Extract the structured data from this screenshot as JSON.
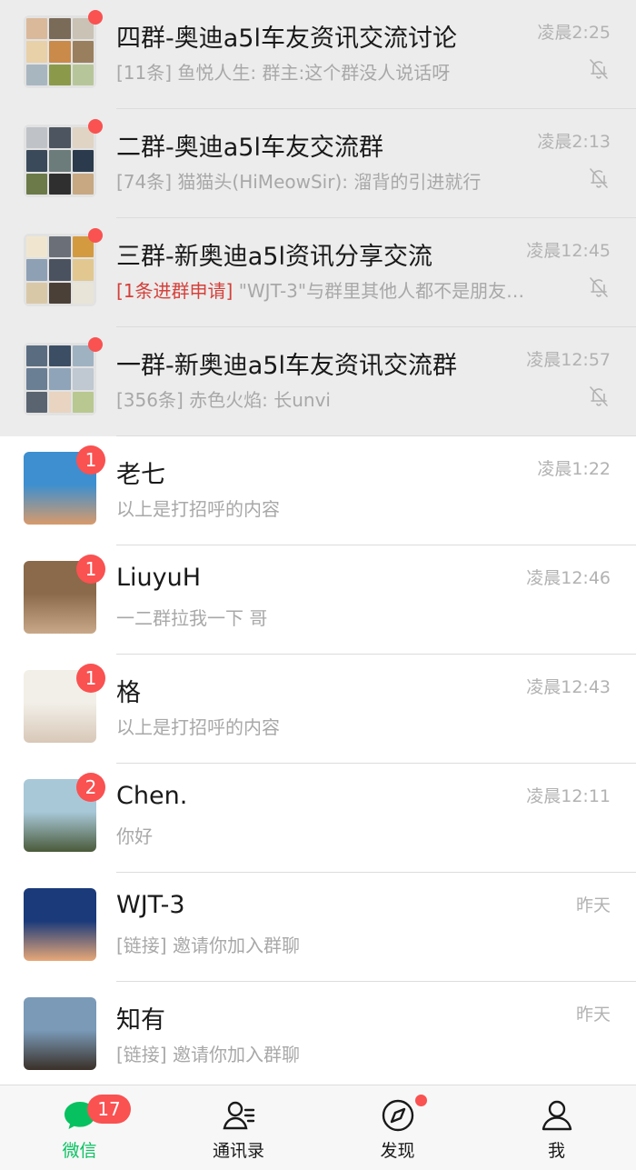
{
  "chats": [
    {
      "name": "四群-奥迪a5l车友资讯交流讨论",
      "time": "凌晨2:25",
      "prefix": "",
      "preview": "[11条] 鱼悦人生: 群主:这个群没人说话呀",
      "pinned": true,
      "muted": true,
      "badge": "",
      "dot": true,
      "avatar_colors": [
        "#d9b99a",
        "#7a6a58",
        "#c9c2b5",
        "#e8d0a8",
        "#c98a4a",
        "#9a7f5e",
        "#a8b6c0",
        "#8b9a4a",
        "#b7c69a"
      ]
    },
    {
      "name": "二群-奥迪a5l车友交流群",
      "time": "凌晨2:13",
      "prefix": "",
      "preview": "[74条] 猫猫头(HiMeowSir): 溜背的引进就行",
      "pinned": true,
      "muted": true,
      "badge": "",
      "dot": true,
      "avatar_colors": [
        "#bfc3c7",
        "#4d5560",
        "#e0d4c4",
        "#3a4a5a",
        "#6c7c7a",
        "#2b3a4c",
        "#6b7a48",
        "#2f2f2f",
        "#c7a882"
      ]
    },
    {
      "name": "三群-新奥迪a5l资讯分享交流",
      "time": "凌晨12:45",
      "prefix": "[1条进群申请]",
      "preview": " \"WJT-3\"与群里其他人都不是朋友…",
      "pinned": true,
      "muted": true,
      "badge": "",
      "dot": true,
      "avatar_colors": [
        "#f0e6d0",
        "#6a6f78",
        "#d49a40",
        "#8ea0b4",
        "#4a5260",
        "#e2c890",
        "#d9c8a8",
        "#4b4038",
        "#e8e4d8"
      ]
    },
    {
      "name": "一群-新奥迪a5l车友资讯交流群",
      "time": "凌晨12:57",
      "prefix": "",
      "preview": "[356条] 赤色火焰: 长unvi",
      "pinned": true,
      "muted": true,
      "badge": "",
      "dot": true,
      "avatar_colors": [
        "#5a6c80",
        "#3c4e64",
        "#9fb2c2",
        "#6a7e94",
        "#8fa4b8",
        "#c0c8d2",
        "#5a6470",
        "#e8d4c0",
        "#b8c890"
      ]
    },
    {
      "name": "老七",
      "time": "凌晨1:22",
      "prefix": "",
      "preview": "以上是打招呼的内容",
      "pinned": false,
      "muted": false,
      "badge": "1",
      "dot": false,
      "avatar_colors": [
        "#3d8fd0",
        "#d89a6a"
      ]
    },
    {
      "name": "LiuyuH",
      "time": "凌晨12:46",
      "prefix": "",
      "preview": "一二群拉我一下 哥",
      "pinned": false,
      "muted": false,
      "badge": "1",
      "dot": false,
      "avatar_colors": [
        "#8a6a4a",
        "#c8a888"
      ]
    },
    {
      "name": "格",
      "time": "凌晨12:43",
      "prefix": "",
      "preview": "以上是打招呼的内容",
      "pinned": false,
      "muted": false,
      "badge": "1",
      "dot": false,
      "avatar_colors": [
        "#f2efe8",
        "#d8c8b8"
      ]
    },
    {
      "name": "Chen.",
      "time": "凌晨12:11",
      "prefix": "",
      "preview": "你好",
      "pinned": false,
      "muted": false,
      "badge": "2",
      "dot": false,
      "avatar_colors": [
        "#a8c8d8",
        "#4a5a3a"
      ]
    },
    {
      "name": "WJT-3",
      "time": "昨天",
      "prefix": "",
      "preview": "[链接] 邀请你加入群聊",
      "pinned": false,
      "muted": false,
      "badge": "",
      "dot": false,
      "avatar_colors": [
        "#1a3a7a",
        "#e8a878"
      ]
    },
    {
      "name": "知有",
      "time": "昨天",
      "prefix": "",
      "preview": "[链接] 邀请你加入群聊",
      "pinned": false,
      "muted": false,
      "badge": "",
      "dot": false,
      "avatar_colors": [
        "#7a9ab8",
        "#3a3028"
      ]
    }
  ],
  "tabbar": {
    "tabs": [
      {
        "label": "微信",
        "icon": "chat-bubble-icon",
        "active": true,
        "badge": "17",
        "dot": false
      },
      {
        "label": "通讯录",
        "icon": "contacts-icon",
        "active": false,
        "badge": "",
        "dot": false
      },
      {
        "label": "发现",
        "icon": "compass-icon",
        "active": false,
        "badge": "",
        "dot": true
      },
      {
        "label": "我",
        "icon": "person-icon",
        "active": false,
        "badge": "",
        "dot": false
      }
    ]
  },
  "colors": {
    "accent": "#07c160",
    "badge": "#fa5151",
    "alert_text": "#d4403a",
    "pinned_bg": "#ececec"
  }
}
